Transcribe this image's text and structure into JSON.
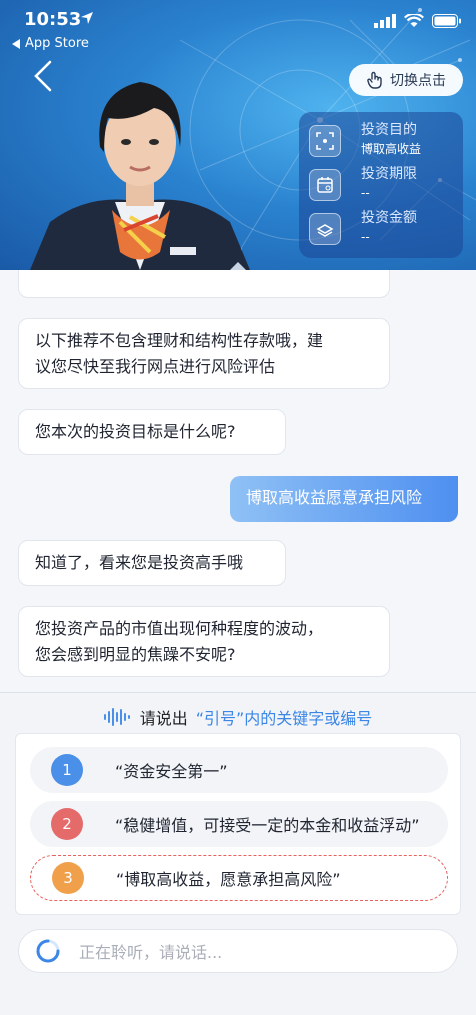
{
  "status_bar": {
    "time": "10:53",
    "back_app": "App Store"
  },
  "header": {
    "switch_label": "切换点击"
  },
  "info_panel": [
    {
      "label": "投资目的",
      "value": "博取高收益",
      "icon": "target-icon"
    },
    {
      "label": "投资期限",
      "value": "--",
      "icon": "calendar-icon"
    },
    {
      "label": "投资金额",
      "value": "--",
      "icon": "money-icon"
    }
  ],
  "chat": {
    "messages": [
      {
        "role": "assistant",
        "lines": [
          "以下推荐不包含理财和结构性存款哦，建",
          "议您尽快至我行网点进行风险评估"
        ]
      },
      {
        "role": "assistant",
        "lines": [
          "您本次的投资目标是什么呢?"
        ]
      },
      {
        "role": "user",
        "lines": [
          "博取高收益愿意承担风险"
        ]
      },
      {
        "role": "assistant",
        "lines": [
          "知道了，看来您是投资高手哦"
        ]
      },
      {
        "role": "assistant",
        "lines": [
          "您投资产品的市值出现何种程度的波动，",
          "您会感到明显的焦躁不安呢?"
        ]
      }
    ]
  },
  "voice_prompt": {
    "lead": "请说出",
    "highlight": "“引号”内的关键字或编号"
  },
  "options": [
    {
      "number": "1",
      "text": "“资金安全第一”",
      "color": "#4a8fe8"
    },
    {
      "number": "2",
      "text": "“稳健增值，可接受一定的本金和收益浮动”",
      "color": "#e56a6a"
    },
    {
      "number": "3",
      "text": "“博取高收益，愿意承担高风险”",
      "color": "#f0a04a",
      "selected": true
    }
  ],
  "listening": {
    "text": "正在聆听，请说话..."
  },
  "colors": {
    "accent": "#3b86e6",
    "user_bubble_end": "#4e8ff0"
  }
}
